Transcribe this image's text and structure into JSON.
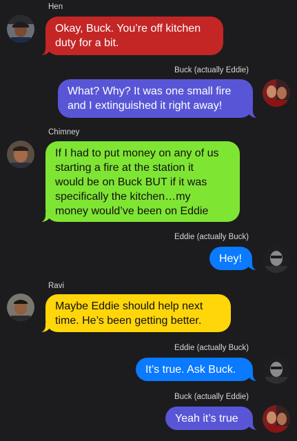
{
  "colors": {
    "background": "#1c1c1e",
    "red": "#c42626",
    "purple": "#5856d6",
    "green": "#7fe533",
    "blue": "#0a7aff",
    "yellow": "#ffd60a"
  },
  "messages": [
    {
      "sender": "Hen",
      "text": "Okay, Buck. You’re off kitchen\nduty for a bit.",
      "avatar": "hen-avatar"
    },
    {
      "sender": "Buck (actually Eddie)",
      "text": "What? Why? It was one small fire\nand I extinguished it right away!",
      "avatar": "buck-avatar"
    },
    {
      "sender": "Chimney",
      "text": "If I had to put money on any of us\nstarting a fire at the station it\nwould be on Buck BUT if it was\nspecifically the kitchen…my\nmoney would’ve been on Eddie",
      "avatar": "chimney-avatar"
    },
    {
      "sender": "Eddie (actually Buck)",
      "text": "Hey!",
      "avatar": "eddie-avatar"
    },
    {
      "sender": "Ravi",
      "text": "Maybe Eddie should help next\ntime. He’s been getting better.",
      "avatar": "ravi-avatar"
    },
    {
      "sender": "Eddie (actually Buck)",
      "text": "It’s true. Ask Buck.",
      "avatar": "eddie-avatar"
    },
    {
      "sender": "Buck (actually Eddie)",
      "text": "Yeah it’s true",
      "avatar": "buck-avatar"
    }
  ]
}
